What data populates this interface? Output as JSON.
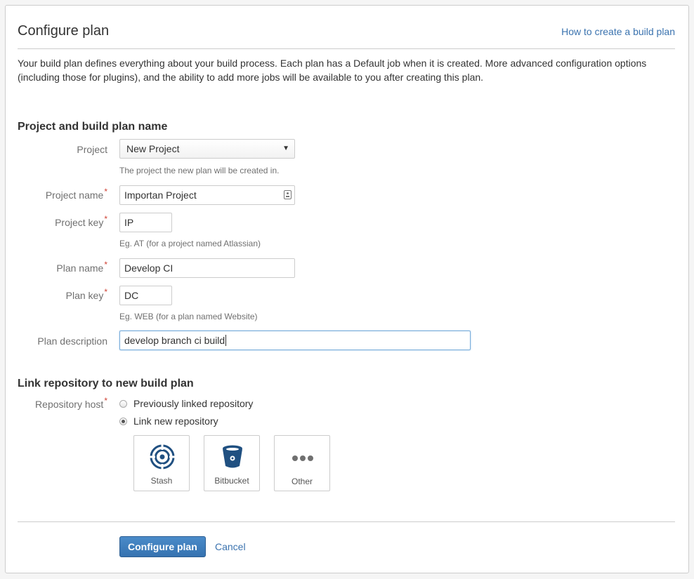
{
  "header": {
    "title": "Configure plan",
    "help_link": "How to create a build plan"
  },
  "intro": "Your build plan defines everything about your build process. Each plan has a Default job when it is created. More advanced configuration options (including those for plugins), and the ability to add more jobs will be available to you after creating this plan.",
  "section_project": {
    "title": "Project and build plan name",
    "project": {
      "label": "Project",
      "value": "New Project",
      "hint": "The project the new plan will be created in."
    },
    "project_name": {
      "label": "Project name",
      "value": "Importan Project"
    },
    "project_key": {
      "label": "Project key",
      "value": "IP",
      "hint": "Eg. AT (for a project named Atlassian)"
    },
    "plan_name": {
      "label": "Plan name",
      "value": "Develop CI"
    },
    "plan_key": {
      "label": "Plan key",
      "value": "DC",
      "hint": "Eg. WEB (for a plan named Website)"
    },
    "plan_description": {
      "label": "Plan description",
      "value": "develop branch ci build"
    },
    "required_marker": "*"
  },
  "section_repo": {
    "title": "Link repository to new build plan",
    "repository_host_label": "Repository host",
    "options": [
      {
        "label": "Previously linked repository",
        "checked": false
      },
      {
        "label": "Link new repository",
        "checked": true
      }
    ],
    "tiles": [
      {
        "label": "Stash",
        "icon": "stash-icon"
      },
      {
        "label": "Bitbucket",
        "icon": "bitbucket-icon"
      },
      {
        "label": "Other",
        "icon": "more-dots-icon"
      }
    ]
  },
  "actions": {
    "submit": "Configure plan",
    "cancel": "Cancel"
  },
  "colors": {
    "link": "#3b73af",
    "primary_button": "#3572b0",
    "required": "#d04437",
    "icon_dark": "#205081"
  }
}
